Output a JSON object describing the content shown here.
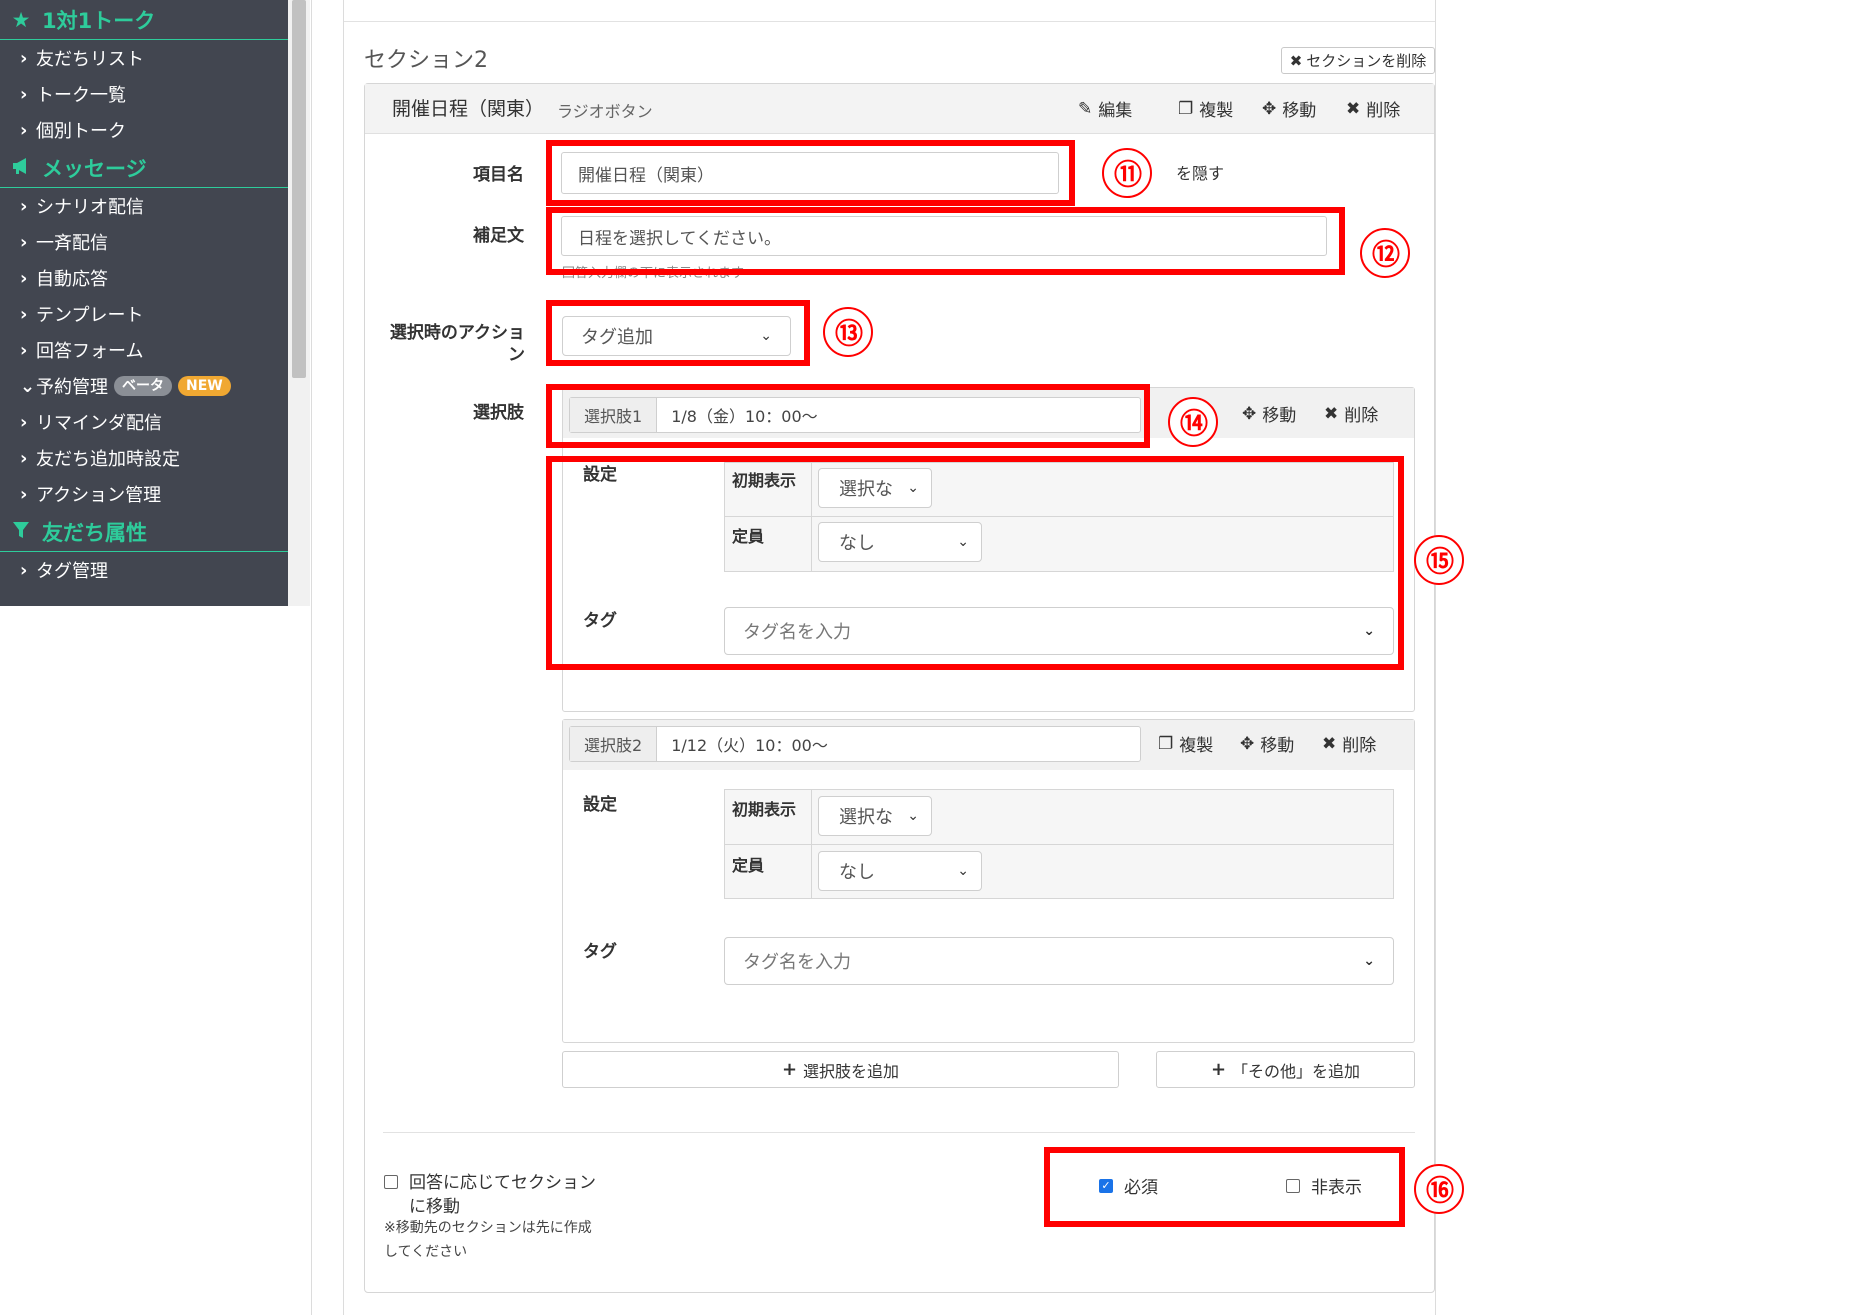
{
  "sidebar": {
    "sections": [
      {
        "title": "1対1トーク",
        "icon": "star-icon",
        "items": [
          "友だちリスト",
          "トーク一覧",
          "個別トーク"
        ]
      },
      {
        "title": "メッセージ",
        "icon": "megaphone-icon",
        "items": [
          "シナリオ配信",
          "一斉配信",
          "自動応答",
          "テンプレート",
          "回答フォーム"
        ]
      },
      {
        "title": "友だち属性",
        "icon": "filter-icon",
        "items": [
          "タグ管理"
        ]
      }
    ],
    "booking": {
      "label": "予約管理",
      "badge_beta": "ベータ",
      "badge_new": "NEW"
    },
    "after_booking": [
      "リマインダ配信",
      "友だち追加時設定",
      "アクション管理"
    ],
    "colors": {
      "background": "#424650",
      "accent": "#2ecc9b"
    }
  },
  "section": {
    "title": "セクション2",
    "delete_label": "セクションを削除"
  },
  "question": {
    "title": "開催日程（関東）",
    "type": "ラジオボタン",
    "actions": {
      "edit": "編集",
      "copy": "複製",
      "move": "移動",
      "delete": "削除"
    },
    "fields": {
      "name_label": "項目名",
      "name_value": "開催日程（関東）",
      "hide_label": "を隠す",
      "supplement_label": "補足文",
      "supplement_value": "日程を選択してください。",
      "supplement_hint": "回答入力欄の下に表示されます",
      "action_label": "選択時のアクション",
      "action_value": "タグ追加",
      "options_label": "選択肢"
    }
  },
  "options": [
    {
      "tag": "選択肢1",
      "value": "1/8（金）10：00～",
      "actions": {
        "move": "移動",
        "delete": "削除"
      },
      "settings_label": "設定",
      "initial_label": "初期表示",
      "initial_value": "選択な",
      "capacity_label": "定員",
      "capacity_value": "なし",
      "tag_label": "タグ",
      "tag_placeholder": "タグ名を入力"
    },
    {
      "tag": "選択肢2",
      "value": "1/12（火）10：00～",
      "actions": {
        "copy": "複製",
        "move": "移動",
        "delete": "削除"
      },
      "settings_label": "設定",
      "initial_label": "初期表示",
      "initial_value": "選択な",
      "capacity_label": "定員",
      "capacity_value": "なし",
      "tag_label": "タグ",
      "tag_placeholder": "タグ名を入力"
    }
  ],
  "buttons": {
    "add_option": "選択肢を追加",
    "add_other": "「その他」を追加"
  },
  "footer": {
    "branch_label_1": "回答に応じてセクション",
    "branch_label_2": "に移動",
    "branch_note_1": "※移動先のセクションは先に作成",
    "branch_note_2": "してください",
    "required_label": "必須",
    "required_checked": true,
    "hidden_label": "非表示",
    "hidden_checked": false
  },
  "annotations": [
    "⑪",
    "⑫",
    "⑬",
    "⑭",
    "⑮",
    "⑯"
  ],
  "annotation_color": "#ff0000"
}
